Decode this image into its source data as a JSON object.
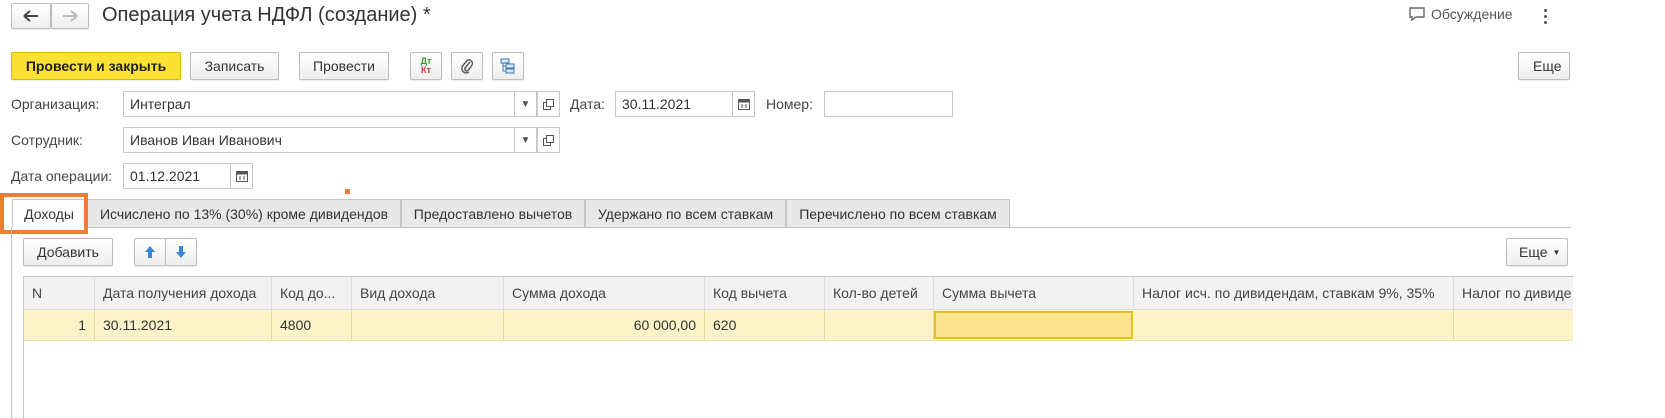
{
  "window": {
    "title": "Операция учета НДФЛ (создание) *",
    "discussion_label": "Обсуждение"
  },
  "toolbar": {
    "post_and_close": "Провести и закрыть",
    "save": "Записать",
    "post": "Провести",
    "dtkt_icon_text_top": "Дт",
    "dtkt_icon_text_bottom": "Кт",
    "more": "Еще"
  },
  "form": {
    "organization_label": "Организация:",
    "organization_value": "Интеграл",
    "date_label": "Дата:",
    "date_value": "30.11.2021",
    "number_label": "Номер:",
    "number_value": "",
    "employee_label": "Сотрудник:",
    "employee_value": "Иванов Иван Иванович",
    "operation_date_label": "Дата операции:",
    "operation_date_value": "01.12.2021"
  },
  "tabs": [
    {
      "label": "Доходы",
      "active": true
    },
    {
      "label": "Исчислено по 13% (30%) кроме дивидендов",
      "active": false
    },
    {
      "label": "Предоставлено вычетов",
      "active": false
    },
    {
      "label": "Удержано по всем ставкам",
      "active": false
    },
    {
      "label": "Перечислено по всем ставкам",
      "active": false
    }
  ],
  "table_toolbar": {
    "add": "Добавить",
    "more": "Еще"
  },
  "table": {
    "columns": [
      "N",
      "Дата получения дохода",
      "Код до...",
      "Вид дохода",
      "Сумма дохода",
      "Код вычета",
      "Кол-во детей",
      "Сумма вычета",
      "Налог исч. по дивидендам, ставкам 9%, 35%",
      "Налог по дивиде"
    ],
    "rows": [
      [
        "1",
        "30.11.2021",
        "4800",
        "",
        "60 000,00",
        "620",
        "",
        "",
        "",
        ""
      ]
    ]
  },
  "colors": {
    "accent_yellow": "#fbe133",
    "highlight_orange": "#ee7d31",
    "row_selected": "#fdf3c9",
    "cell_active": "#fde58f"
  },
  "icons": [
    "back-arrow-icon",
    "forward-arrow-icon",
    "chat-icon",
    "kebab-menu-icon",
    "dt-kt-icon",
    "paperclip-icon",
    "structure-icon",
    "dropdown-icon",
    "open-icon",
    "calendar-icon",
    "arrow-up-icon",
    "arrow-down-icon"
  ]
}
